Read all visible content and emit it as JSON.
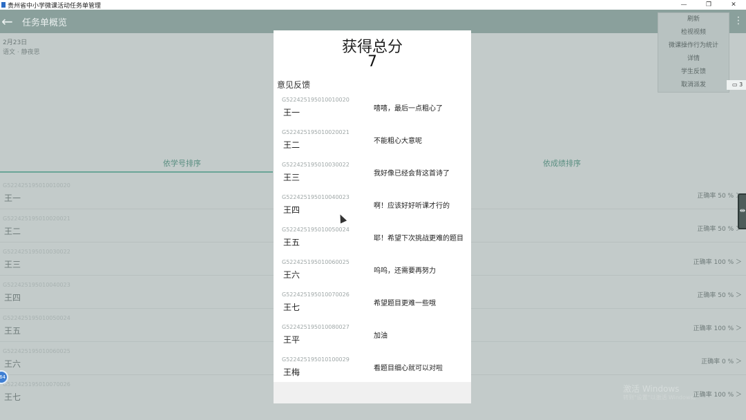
{
  "window": {
    "title": "贵州省中小学微课活动任务单管理",
    "controls": [
      "—",
      "❐",
      "✕"
    ]
  },
  "appbar": {
    "back_icon": "←",
    "title": "任务单概览",
    "kebab": "⋮"
  },
  "page": {
    "date": "2月23日",
    "subtitle": "语文 · 静夜思",
    "tabs": [
      "依学号排序",
      "依成绩排序"
    ],
    "rows": [
      {
        "id": "G522425195010010020",
        "name": "王一",
        "rate": "正确率 50 % ＞"
      },
      {
        "id": "G522425195010020021",
        "name": "王二",
        "rate": "正确率 50 % ＞"
      },
      {
        "id": "G522425195010030022",
        "name": "王三",
        "rate": "正确率 100 % ＞"
      },
      {
        "id": "G522425195010040023",
        "name": "王四",
        "rate": "正确率 50 % ＞"
      },
      {
        "id": "G522425195010050024",
        "name": "王五",
        "rate": "正确率 100 % ＞"
      },
      {
        "id": "G522425195010060025",
        "name": "王六",
        "rate": "正确率 0 % ＞"
      },
      {
        "id": "G522425195010070026",
        "name": "王七",
        "rate": "正确率 100 % ＞"
      }
    ],
    "edge_handle": "⇹",
    "blue_dot": "64",
    "watermark": "激活 Windows",
    "watermark_sub": "转到\"设置\"以激活 Windows。"
  },
  "menu": {
    "items": [
      "刷新",
      "检视视频",
      "微课操作行为统计",
      "详情",
      "学生反馈",
      "取消派发"
    ],
    "side_icon": "▭ 3"
  },
  "modal": {
    "title": "获得总分",
    "score": "7",
    "section": "意见反馈",
    "feedback": [
      {
        "id": "G522425195010010020",
        "name": "王一",
        "text": "嘻嘻，最后一点粗心了"
      },
      {
        "id": "G522425195010020021",
        "name": "王二",
        "text": "不能粗心大意呢"
      },
      {
        "id": "G522425195010030022",
        "name": "王三",
        "text": "我好像已经会背这首诗了"
      },
      {
        "id": "G522425195010040023",
        "name": "王四",
        "text": "啊！应该好好听课才行的"
      },
      {
        "id": "G522425195010050024",
        "name": "王五",
        "text": "耶！希望下次挑战更难的题目"
      },
      {
        "id": "G522425195010060025",
        "name": "王六",
        "text": "呜呜，还需要再努力"
      },
      {
        "id": "G522425195010070026",
        "name": "王七",
        "text": "希望题目更难一些哦"
      },
      {
        "id": "G522425195010080027",
        "name": "王平",
        "text": "加油"
      },
      {
        "id": "G522425195010100029",
        "name": "王梅",
        "text": "看题目细心就可以对啦"
      }
    ]
  }
}
